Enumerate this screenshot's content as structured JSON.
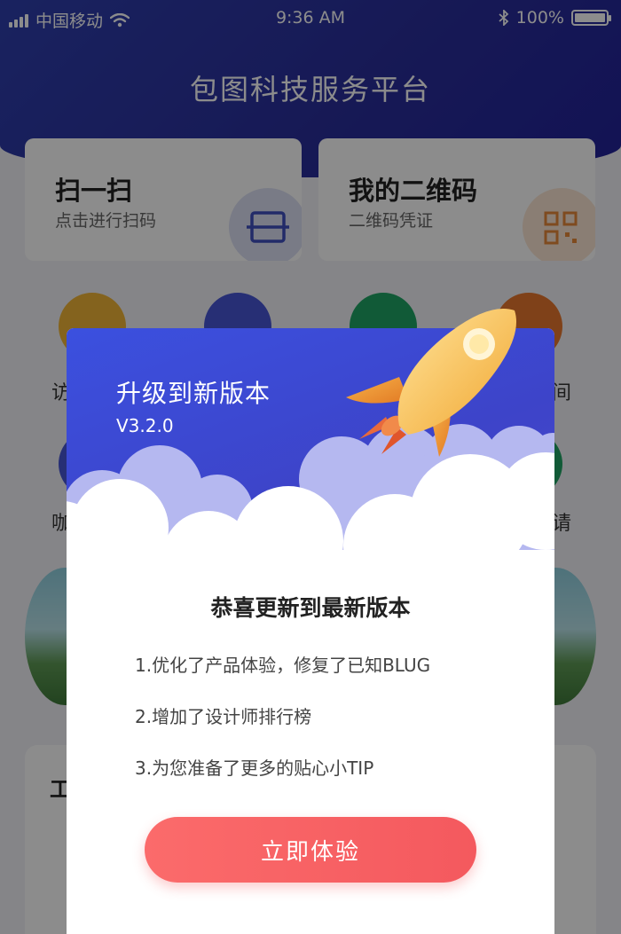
{
  "status_bar": {
    "carrier": "中国移动",
    "time": "9:36 AM",
    "battery": "100%",
    "battery_level": 1.0,
    "icons": [
      "signal-icon",
      "wifi-icon",
      "bluetooth-icon",
      "battery-icon"
    ]
  },
  "app": {
    "title": "包图科技服务平台",
    "cards": [
      {
        "title": "扫一扫",
        "subtitle": "点击进行扫码",
        "icon": "scan-icon",
        "icon_color": "#3e4fc0"
      },
      {
        "title": "我的二维码",
        "subtitle": "二维码凭证",
        "icon": "qr-code-icon",
        "icon_color": "#e8893a"
      }
    ],
    "feature_colors": [
      "#f0b437",
      "#4856d6",
      "#1fa564",
      "#e8772e"
    ],
    "partial_labels": {
      "row1_left": "访",
      "row1_right": "间",
      "row2_left": "咖",
      "row2_right": "请",
      "section_left": "工"
    }
  },
  "dialog": {
    "title": "升级到新版本",
    "version": "V3.2.0",
    "heading": "恭喜更新到最新版本",
    "items": [
      "1.优化了产品体验，修复了已知BLUG",
      "2.增加了设计师排行榜",
      "3.为您准备了更多的贴心小TIP"
    ],
    "button_label": "立即体验",
    "header_color": "#3b4ad4",
    "button_color": "#f65a5f",
    "illustration": "rocket-icon"
  }
}
